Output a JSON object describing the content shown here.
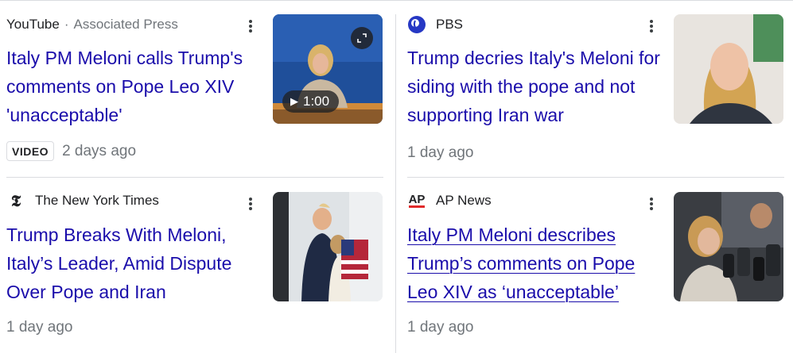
{
  "cards": [
    {
      "source": "YouTube",
      "separator": "·",
      "publisher": "Associated Press",
      "title": "Italy PM Meloni calls Trump's comments on Pope Leo XIV 'unacceptable'",
      "badge": "VIDEO",
      "time": "2 days ago",
      "duration": "1:00",
      "thumbnail_icon": "video-thumbnail"
    },
    {
      "source": "PBS",
      "logo_icon": "pbs-logo-icon",
      "title": "Trump decries Italy's Meloni for siding with the pope and not supporting Iran war",
      "time": "1 day ago",
      "thumbnail_icon": "portrait-thumbnail"
    },
    {
      "source": "The New York Times",
      "logo_icon": "nyt-logo-icon",
      "logo_glyph": "𝕿",
      "title": "Trump Breaks With Meloni, Italy’s Leader, Amid Dispute Over Pope and Iran",
      "time": "1 day ago",
      "thumbnail_icon": "photo-thumbnail"
    },
    {
      "source": "AP News",
      "logo_icon": "ap-logo-icon",
      "logo_text": "AP",
      "title": "Italy PM Meloni describes Trump’s comments on Pope Leo XIV as ‘unacceptable’",
      "time": "1 day ago",
      "thumbnail_icon": "photo-thumbnail"
    }
  ],
  "colors": {
    "link": "#1a0dab",
    "meta": "#70757a",
    "divider": "#dadce0"
  }
}
